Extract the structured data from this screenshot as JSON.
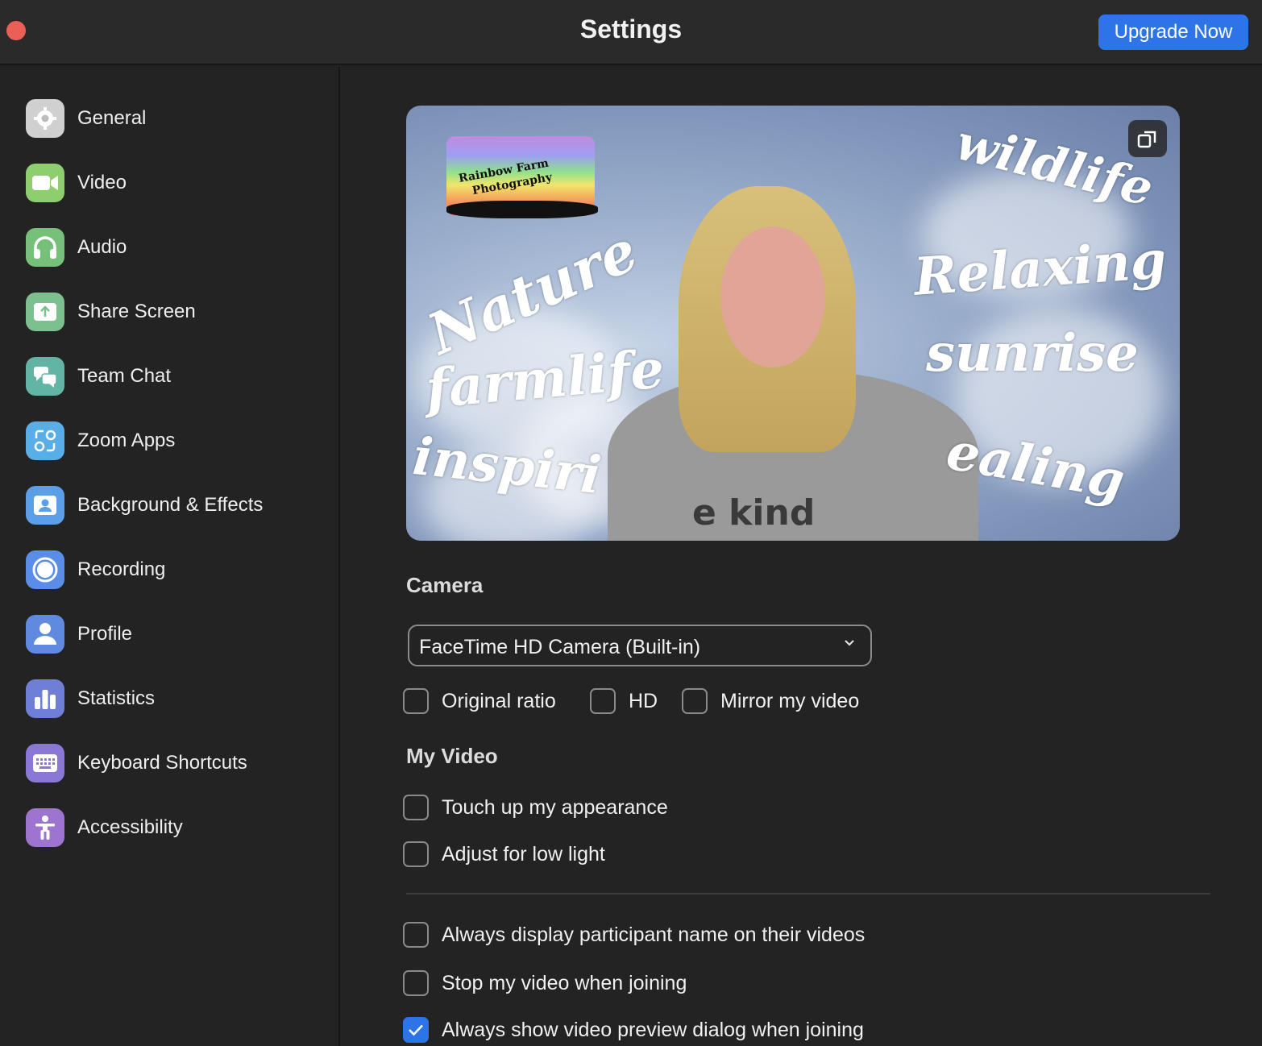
{
  "window": {
    "title": "Settings",
    "upgrade_label": "Upgrade Now"
  },
  "sidebar": {
    "items": [
      {
        "label": "General",
        "icon": "gear-icon",
        "color": "#cfcfcf"
      },
      {
        "label": "Video",
        "icon": "video-camera-icon",
        "color": "#8fce6e"
      },
      {
        "label": "Audio",
        "icon": "headphones-icon",
        "color": "#77c07a"
      },
      {
        "label": "Share Screen",
        "icon": "share-screen-icon",
        "color": "#7cc08f"
      },
      {
        "label": "Team Chat",
        "icon": "chat-bubbles-icon",
        "color": "#62b5a5"
      },
      {
        "label": "Zoom Apps",
        "icon": "apps-icon",
        "color": "#5aaee8"
      },
      {
        "label": "Background & Effects",
        "icon": "person-frame-icon",
        "color": "#5a9fe8"
      },
      {
        "label": "Recording",
        "icon": "record-icon",
        "color": "#5a8de8"
      },
      {
        "label": "Profile",
        "icon": "person-icon",
        "color": "#5f8ae0"
      },
      {
        "label": "Statistics",
        "icon": "bar-chart-icon",
        "color": "#6f7fd8"
      },
      {
        "label": "Keyboard Shortcuts",
        "icon": "keyboard-icon",
        "color": "#8b78d6"
      },
      {
        "label": "Accessibility",
        "icon": "accessibility-icon",
        "color": "#9d74d0"
      }
    ]
  },
  "preview": {
    "logo_line1": "Rainbow Farm",
    "logo_line2": "Photography",
    "words": [
      "wildlife",
      "Nature",
      "Relaxing",
      "sunrise",
      "farmlife",
      "inspiri",
      "ealing"
    ],
    "shirt_text": "e kind"
  },
  "camera": {
    "title": "Camera",
    "selected": "FaceTime HD Camera (Built-in)",
    "original_ratio": "Original ratio",
    "hd": "HD",
    "mirror": "Mirror my video"
  },
  "my_video": {
    "title": "My Video",
    "touch_up": "Touch up my appearance",
    "low_light": "Adjust for low light"
  },
  "options": {
    "display_names": "Always display participant name on their videos",
    "stop_video": "Stop my video when joining",
    "show_preview": "Always show video preview dialog when joining",
    "show_preview_checked": true
  }
}
